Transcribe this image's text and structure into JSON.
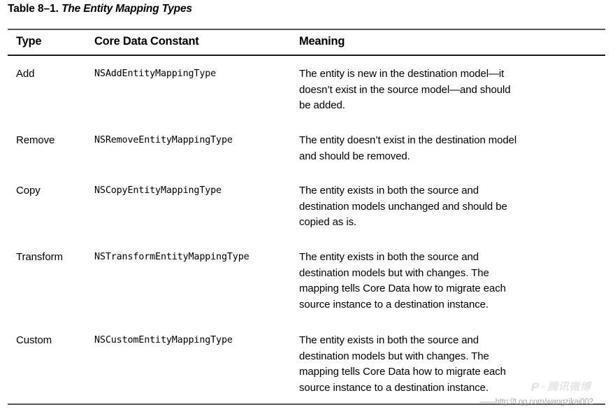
{
  "caption": {
    "label": "Table 8–1.",
    "title": "The Entity Mapping Types"
  },
  "table": {
    "headers": {
      "type": "Type",
      "constant": "Core Data Constant",
      "meaning": "Meaning"
    },
    "rows": [
      {
        "type": "Add",
        "constant": "NSAddEntityMappingType",
        "meaning": "The entity is new in the destination model—it doesn’t exist in the source model—and should be added.",
        "meaning_lines": [
          "The entity is new in the destination model—it",
          "doesn’t exist in the source model—and should",
          "be added."
        ]
      },
      {
        "type": "Remove",
        "constant": "NSRemoveEntityMappingType",
        "meaning": "The entity doesn’t exist in the destination model and should be removed.",
        "meaning_lines": [
          "The entity doesn’t exist in the destination model",
          "and should be removed."
        ]
      },
      {
        "type": "Copy",
        "constant": "NSCopyEntityMappingType",
        "meaning": "The entity exists in both the source and destination models unchanged and should be copied as is.",
        "meaning_lines": [
          "The entity exists in both the source and",
          "destination models unchanged and should be",
          "copied as is."
        ]
      },
      {
        "type": "Transform",
        "constant": "NSTransformEntityMappingType",
        "meaning": "The entity exists in both the source and destination models but with changes. The mapping tells Core Data how to migrate each source instance to a destination instance.",
        "meaning_lines": [
          "The entity exists in both the source and",
          "destination models but with changes. The",
          "mapping tells Core Data how to migrate each",
          "source instance to a destination instance."
        ]
      },
      {
        "type": "Custom",
        "constant": "NSCustomEntityMappingType",
        "meaning": "The entity exists in both the source and destination models but with changes. The mapping tells Core Data how to migrate each source instance to a destination instance.",
        "meaning_lines": [
          "The entity exists in both the source and",
          "destination models but with changes. The",
          "mapping tells Core Data how to migrate each",
          "source instance to a destination instance."
        ]
      }
    ]
  },
  "watermark": {
    "mark": "P",
    "sup": "®",
    "brand_cn": "腾讯微博",
    "url": "http://t.qq.com/wangzikai002",
    "dash": "——"
  }
}
